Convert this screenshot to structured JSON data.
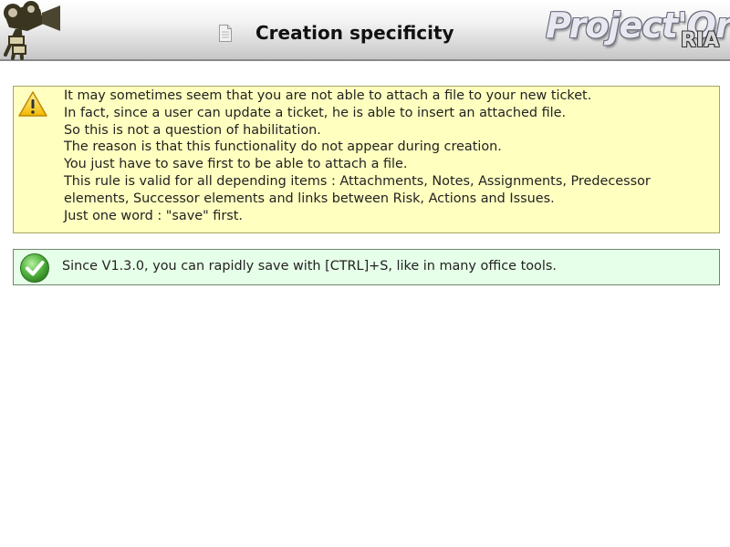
{
  "header": {
    "title": "Creation specificity",
    "brand_name": "Project'Or",
    "brand_suffix": "RIA",
    "logo_icon": "projector-logo-icon",
    "page_icon": "document-icon"
  },
  "warning": {
    "icon": "warning-icon",
    "lines": [
      "It may sometimes seem that you are not able to attach a file to your new ticket.",
      "In fact, since a user can update a ticket, he is able to insert an attached file.",
      "So this is not a question of habilitation.",
      "The reason is that this functionality do not appear during creation.",
      "You just have to save first to be able to attach a file.",
      "This rule is valid for all depending items : Attachments, Notes, Assignments, Predecessor elements, Successor elements and links between Risk, Actions and Issues.",
      "Just one word : \"save\" first."
    ]
  },
  "tip": {
    "icon": "check-icon",
    "text": "Since V1.3.0, you can rapidly save with [CTRL]+S, like in many office tools."
  },
  "colors": {
    "warning_bg": "#ffffc0",
    "tip_bg": "#e6ffe8",
    "header_border": "#8a8a8a"
  }
}
